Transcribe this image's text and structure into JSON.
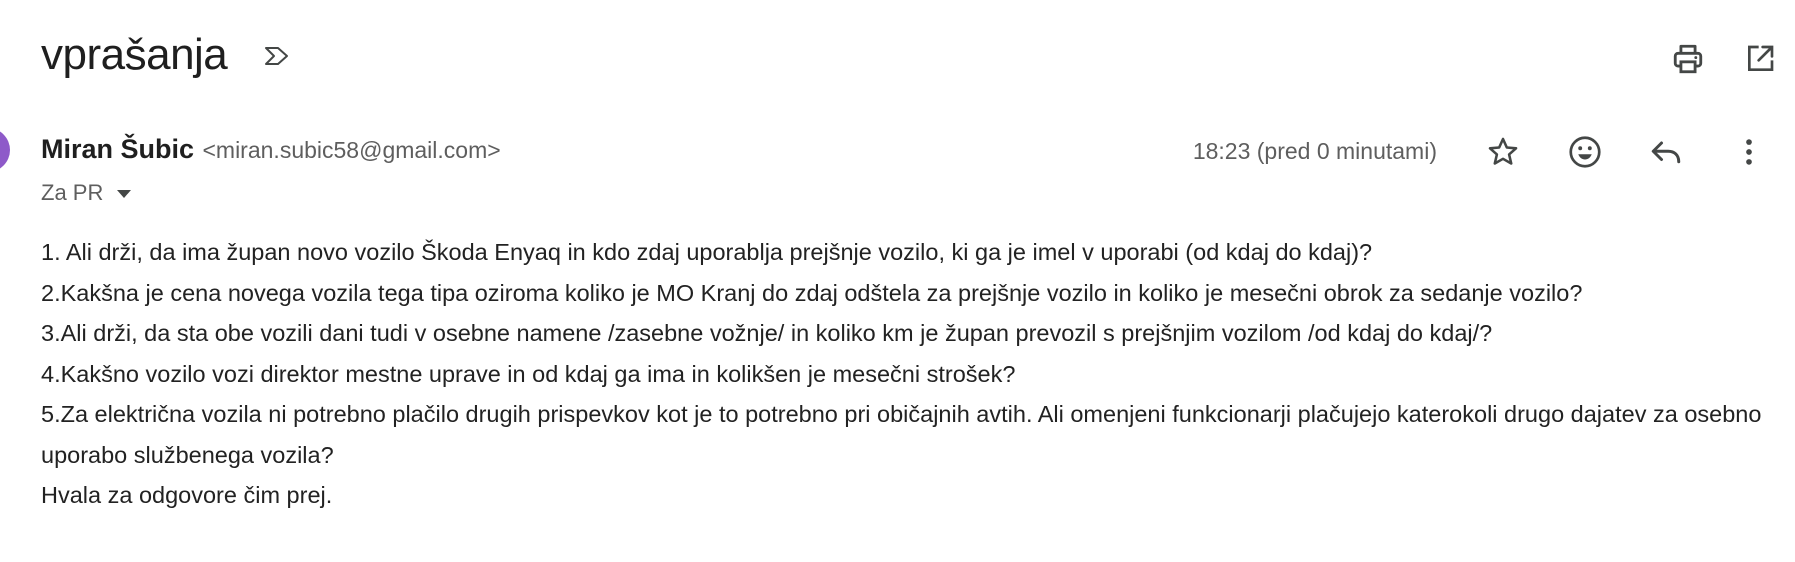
{
  "email": {
    "subject": "vprašanja",
    "sender_name": "Miran Šubic",
    "sender_email": "<miran.subic58@gmail.com>",
    "recipient": "Za PR",
    "time": "18:23 (pred 0 minutami)",
    "body": [
      "1. Ali drži, da ima župan novo vozilo Škoda Enyaq in kdo zdaj uporablja prejšnje vozilo, ki ga je imel v uporabi (od kdaj do kdaj)?",
      "2.Kakšna je cena novega vozila tega tipa oziroma koliko je MO Kranj do zdaj odštela za prejšnje vozilo in koliko je mesečni obrok za sedanje vozilo?",
      "3.Ali drži, da sta obe vozili dani tudi v osebne namene /zasebne vožnje/ in koliko km je župan prevozil s prejšnjim vozilom /od kdaj do kdaj/?",
      "4.Kakšno vozilo vozi direktor mestne uprave in od kdaj ga ima in kolikšen je mesečni strošek?",
      "5.Za električna vozila ni potrebno plačilo drugih prispevkov kot je to potrebno pri običajnih avtih. Ali omenjeni funkcionarji plačujejo katerokoli drugo dajatev za osebno uporabo službenega vozila?",
      "Hvala za odgovore čim prej."
    ]
  },
  "icons": {
    "importance": "label-arrow-icon",
    "print": "print-icon",
    "open_new_window": "open-in-new-icon",
    "star": "star-icon",
    "emoji": "emoji-icon",
    "reply": "reply-icon",
    "more": "more-vert-icon",
    "avatar_color": "#8e5ac9"
  }
}
